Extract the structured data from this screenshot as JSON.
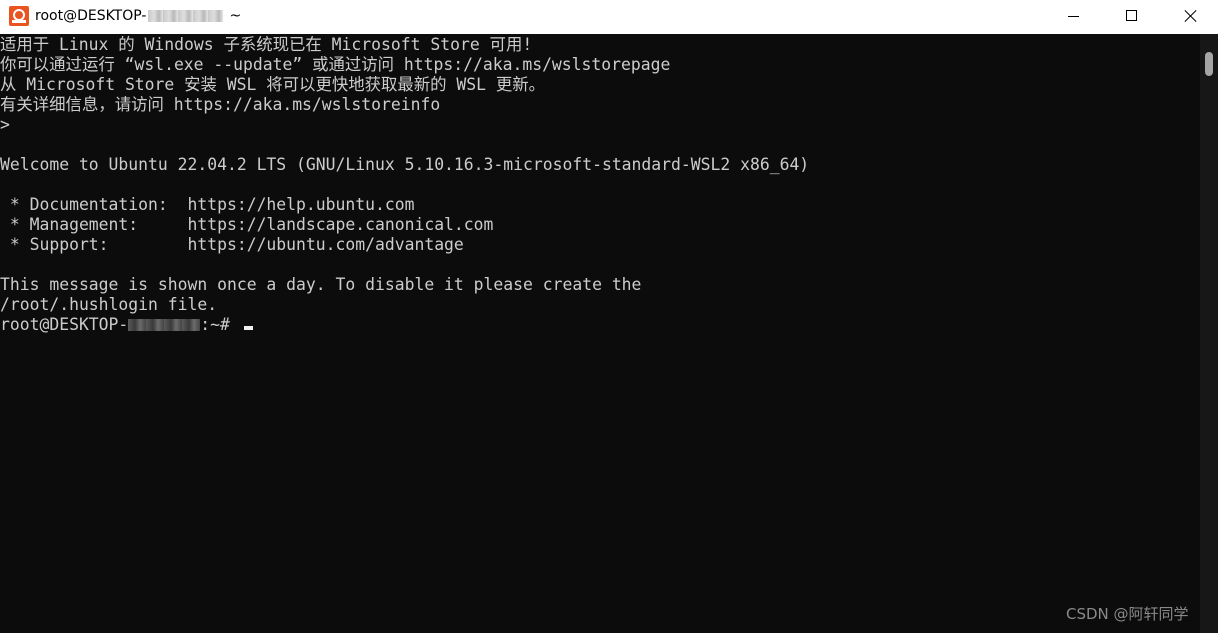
{
  "window": {
    "title_prefix": "root@DESKTOP-",
    "title_suffix": "~"
  },
  "terminal": {
    "lines": [
      "适用于 Linux 的 Windows 子系统现已在 Microsoft Store 可用!",
      "你可以通过运行 “wsl.exe --update” 或通过访问 https://aka.ms/wslstorepage",
      "从 Microsoft Store 安装 WSL 将可以更快地获取最新的 WSL 更新。",
      "有关详细信息，请访问 https://aka.ms/wslstoreinfo",
      ">",
      "",
      "Welcome to Ubuntu 22.04.2 LTS (GNU/Linux 5.10.16.3-microsoft-standard-WSL2 x86_64)",
      "",
      " * Documentation:  https://help.ubuntu.com",
      " * Management:     https://landscape.canonical.com",
      " * Support:        https://ubuntu.com/advantage",
      "",
      "This message is shown once a day. To disable it please create the",
      "/root/.hushlogin file."
    ],
    "prompt_prefix": "root@DESKTOP-",
    "prompt_suffix": ":~# "
  },
  "watermark": "CSDN @阿轩同学",
  "colors": {
    "terminal_bg": "#0c0c0c",
    "terminal_fg": "#cccccc",
    "titlebar_bg": "#ffffff",
    "ubuntu_orange": "#e95420"
  },
  "icons": {
    "app": "ubuntu-icon",
    "minimize": "minimize-icon",
    "maximize": "maximize-icon",
    "close": "close-icon"
  }
}
